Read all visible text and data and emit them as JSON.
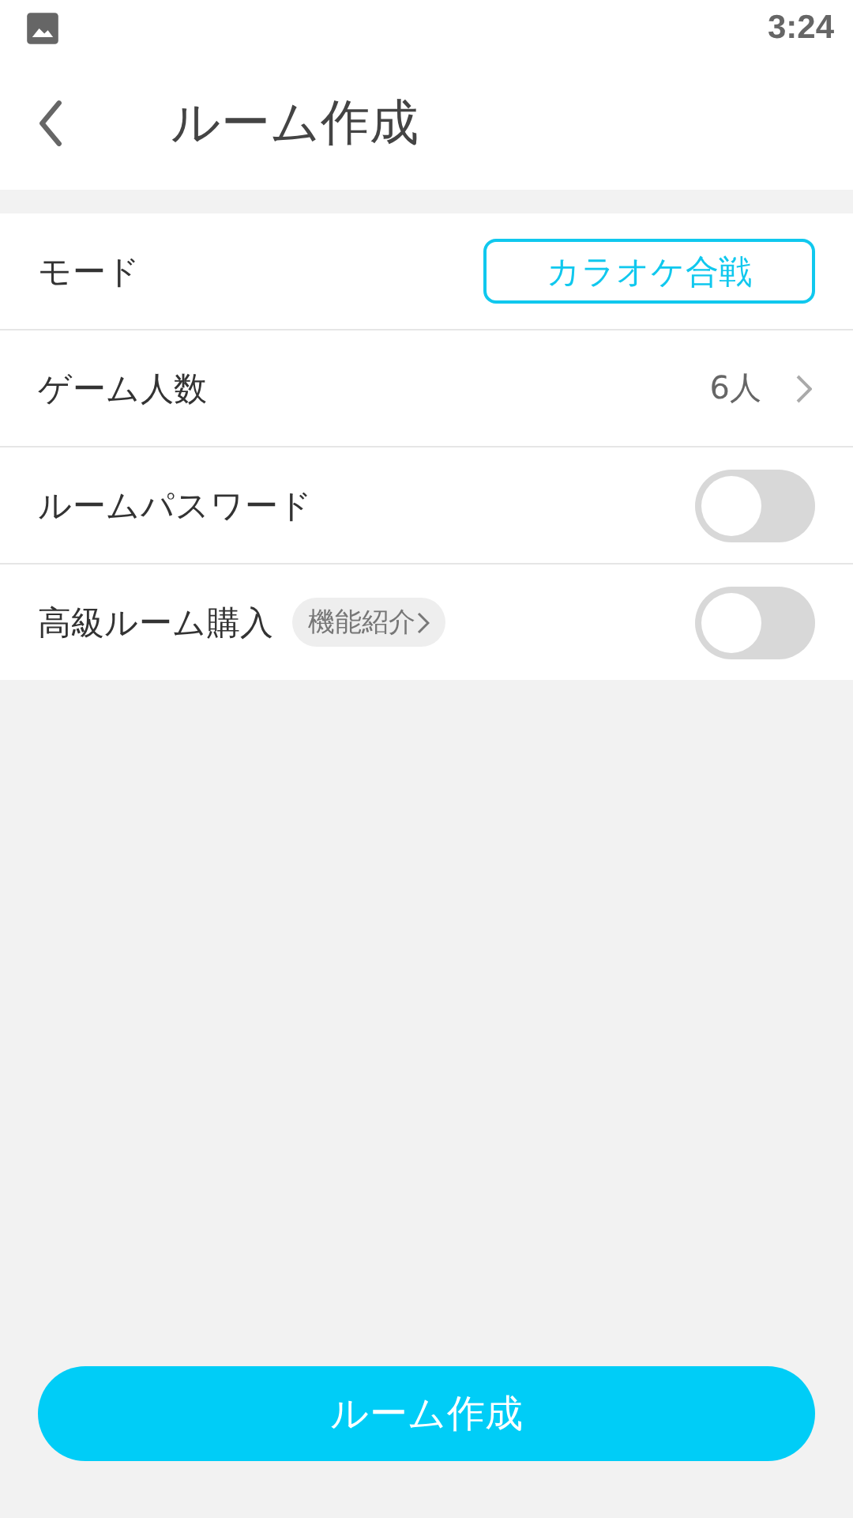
{
  "status_bar": {
    "time": "3:24"
  },
  "header": {
    "title": "ルーム作成"
  },
  "rows": [
    {
      "kind": "mode",
      "label": "モード",
      "value": "カラオケ合戦"
    },
    {
      "kind": "value",
      "label": "ゲーム人数",
      "value": "6人"
    },
    {
      "kind": "toggle",
      "label": "ルームパスワード",
      "on": false
    },
    {
      "kind": "toggle",
      "label": "高級ルーム購入",
      "chip": "機能紹介",
      "on": false
    }
  ],
  "create_button": "ルーム作成"
}
